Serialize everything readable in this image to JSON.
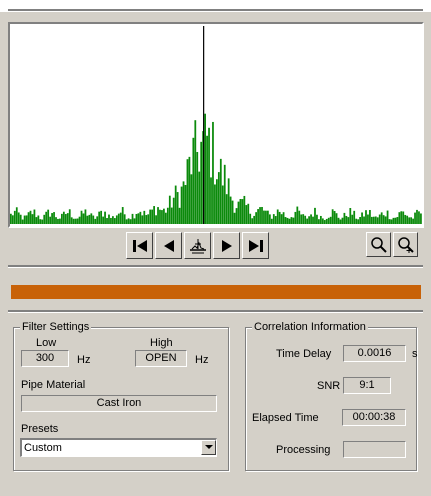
{
  "colors": {
    "spectrum": "#0b8a0b",
    "peak_line": "#000000",
    "progress": "#c86208",
    "panel": "#d4d0c8"
  },
  "plot": {
    "peak_position": 0.47,
    "bins": 210
  },
  "transport": {
    "buttons": [
      "skip-to-start-icon",
      "step-back-icon",
      "center-marker-icon",
      "step-forward-icon",
      "skip-to-end-icon"
    ]
  },
  "zoom": {
    "buttons": [
      "zoom-out-icon",
      "zoom-in-icon"
    ]
  },
  "progress": {
    "fraction": 1.0
  },
  "filter_settings": {
    "title": "Filter Settings",
    "low_label": "Low",
    "high_label": "High",
    "low_value": "300",
    "high_value": "OPEN",
    "low_unit": "Hz",
    "high_unit": "Hz",
    "pipe_material_label": "Pipe Material",
    "pipe_material_value": "Cast Iron",
    "presets_label": "Presets",
    "presets_value": "Custom"
  },
  "correlation": {
    "title": "Correlation Information",
    "time_delay_label": "Time Delay",
    "time_delay_value": "0.0016",
    "time_delay_unit": "s",
    "snr_label": "SNR",
    "snr_value": "9:1",
    "elapsed_label": "Elapsed Time",
    "elapsed_value": "00:00:38",
    "processing_label": "Processing",
    "processing_value": ""
  }
}
